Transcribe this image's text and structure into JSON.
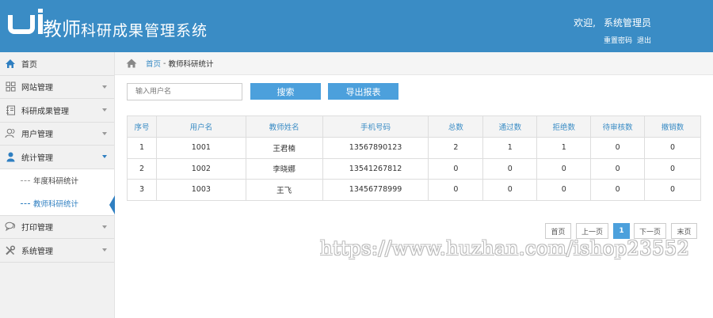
{
  "header": {
    "title_main": "教师",
    "title_sub": "科研成果管理系统",
    "welcome": "欢迎,",
    "user": "系统管理员",
    "reset_password": "重置密码",
    "logout": "退出"
  },
  "sidebar": {
    "items": [
      {
        "label": "首页",
        "icon": "home-icon"
      },
      {
        "label": "网站管理",
        "icon": "grid-icon"
      },
      {
        "label": "科研成果管理",
        "icon": "notebook-icon"
      },
      {
        "label": "用户管理",
        "icon": "users-icon"
      },
      {
        "label": "统计管理",
        "icon": "user-icon"
      },
      {
        "label": "打印管理",
        "icon": "chat-icon"
      },
      {
        "label": "系统管理",
        "icon": "tools-icon"
      }
    ],
    "sub_items": [
      {
        "label": "年度科研统计"
      },
      {
        "label": "教师科研统计"
      }
    ]
  },
  "breadcrumb": {
    "home": "首页",
    "separator": "-",
    "current": "教师科研统计"
  },
  "toolbar": {
    "search_placeholder": "输入用户名",
    "search_button": "搜索",
    "export_button": "导出报表"
  },
  "table": {
    "headers": [
      "序号",
      "用户名",
      "教师姓名",
      "手机号码",
      "总数",
      "通过数",
      "拒绝数",
      "待审核数",
      "撤销数"
    ],
    "rows": [
      [
        "1",
        "1001",
        "王君楠",
        "13567890123",
        "2",
        "1",
        "1",
        "0",
        "0"
      ],
      [
        "2",
        "1002",
        "李晓娜",
        "13541267812",
        "0",
        "0",
        "0",
        "0",
        "0"
      ],
      [
        "3",
        "1003",
        "王飞",
        "13456778999",
        "0",
        "0",
        "0",
        "0",
        "0"
      ]
    ]
  },
  "pagination": {
    "first": "首页",
    "prev": "上一页",
    "current": "1",
    "next": "下一页",
    "last": "末页"
  },
  "watermark": "https://www.huzhan.com/ishop23552",
  "colors": {
    "header_bg": "#3a8cc5",
    "accent": "#4ca0dc",
    "link": "#2f7fc1"
  }
}
